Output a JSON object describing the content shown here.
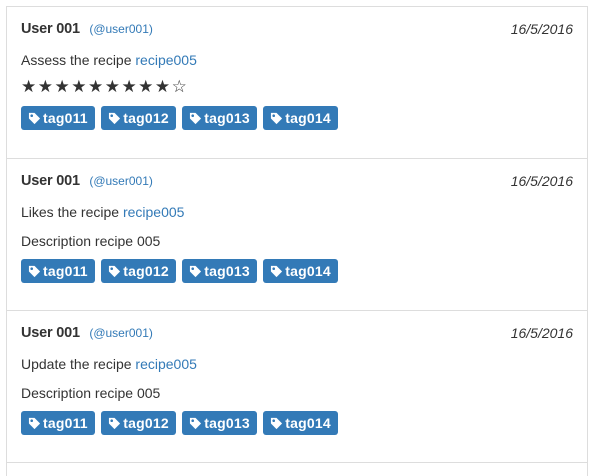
{
  "feed": [
    {
      "user": "User 001",
      "handle": "(@user001)",
      "date": "16/5/2016",
      "action_text": "Assess the recipe ",
      "recipe_link": "recipe005",
      "rating_stars": "★★★★★★★★★☆",
      "rating_value": 9,
      "rating_max": 10,
      "description": "",
      "tags": [
        "tag011",
        "tag012",
        "tag013",
        "tag014"
      ]
    },
    {
      "user": "User 001",
      "handle": "(@user001)",
      "date": "16/5/2016",
      "action_text": "Likes the recipe ",
      "recipe_link": "recipe005",
      "description": "Description recipe 005",
      "tags": [
        "tag011",
        "tag012",
        "tag013",
        "tag014"
      ]
    },
    {
      "user": "User 001",
      "handle": "(@user001)",
      "date": "16/5/2016",
      "action_text": "Update the recipe ",
      "recipe_link": "recipe005",
      "description": "Description recipe 005",
      "tags": [
        "tag011",
        "tag012",
        "tag013",
        "tag014"
      ]
    }
  ],
  "colors": {
    "link": "#337ab7",
    "tag_bg": "#337ab7",
    "tag_text": "#ffffff",
    "border": "#dddddd"
  },
  "icons": {
    "tag": "tag-icon",
    "star": "star-icon"
  }
}
